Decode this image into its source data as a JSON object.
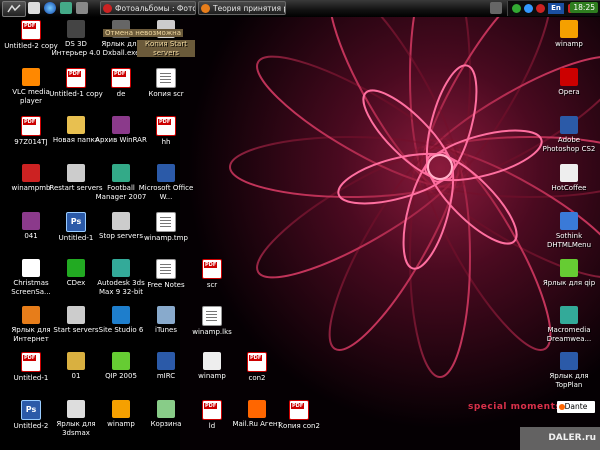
{
  "taskbar": {
    "start_label": "",
    "tasks": [
      {
        "label": "Фотоальбомы : Фото..."
      },
      {
        "label": "Теория принятия ре..."
      }
    ],
    "language": "En",
    "clock": "18:25"
  },
  "desktop": {
    "icons": [
      {
        "label": "Untitled-2 copy",
        "icon": "pdf-icon"
      },
      {
        "label": "DS 3D Интерьер 4.0",
        "icon": "ds3d-icon"
      },
      {
        "label": "Ярлык для Dxball.exe",
        "icon": "dxball-icon"
      },
      {
        "label": "Копия Start servers",
        "icon": "batch-icon",
        "note": "Отмена невозможна"
      },
      {
        "label": "VLC media player",
        "icon": "vlc-cone-icon"
      },
      {
        "label": "Untitled-1 copy",
        "icon": "pdf-icon"
      },
      {
        "label": "de",
        "icon": "pdf-icon"
      },
      {
        "label": "Копия scr",
        "icon": "text-file-icon"
      },
      {
        "label": "97Z014TJ",
        "icon": "pdf-icon"
      },
      {
        "label": "Новая папка",
        "icon": "folder-icon"
      },
      {
        "label": "Архив WinRAR",
        "icon": "winrar-icon"
      },
      {
        "label": "hh",
        "icon": "pdf-icon"
      },
      {
        "label": "winampmb",
        "icon": "winampmb-icon"
      },
      {
        "label": "Restart servers",
        "icon": "batch-icon"
      },
      {
        "label": "Football Manager 2007",
        "icon": "football-manager-icon"
      },
      {
        "label": "Microsoft Office W...",
        "icon": "word-icon"
      },
      {
        "label": "041",
        "icon": "winrar-icon"
      },
      {
        "label": "Untitled-1",
        "icon": "photoshop-icon"
      },
      {
        "label": "Stop servers",
        "icon": "batch-icon"
      },
      {
        "label": "winamp.tmp",
        "icon": "text-file-icon"
      },
      {
        "label": "Christmas ScreenSa...",
        "icon": "snowflake-icon"
      },
      {
        "label": "CDex",
        "icon": "cdex-icon"
      },
      {
        "label": "Autodesk 3ds Max 9 32-bit",
        "icon": "3dsmax-icon"
      },
      {
        "label": "Free Notes",
        "icon": "text-file-icon"
      },
      {
        "label": "scr",
        "icon": "pdf-icon"
      },
      {
        "label": "Ярлык для Интернет",
        "icon": "firefox-icon"
      },
      {
        "label": "Start servers",
        "icon": "batch-icon"
      },
      {
        "label": "Site Studio 6",
        "icon": "site-studio-icon"
      },
      {
        "label": "iTunes",
        "icon": "itunes-icon"
      },
      {
        "label": "winamp.lks",
        "icon": "text-file-icon"
      },
      {
        "label": "Untitled-1",
        "icon": "pdf-icon"
      },
      {
        "label": "01",
        "icon": "zip-icon"
      },
      {
        "label": "QIP 2005",
        "icon": "qip-icon"
      },
      {
        "label": "mIRC",
        "icon": "mirc-icon"
      },
      {
        "label": "winamp",
        "icon": "shortcut-icon"
      },
      {
        "label": "con2",
        "icon": "pdf-icon"
      },
      {
        "label": "Untitled-2",
        "icon": "photoshop-icon"
      },
      {
        "label": "Ярлык для 3dsmax",
        "icon": "window-icon"
      },
      {
        "label": "winamp",
        "icon": "winamp-icon"
      },
      {
        "label": "Корзина",
        "icon": "recycle-bin-icon"
      },
      {
        "label": "ld",
        "icon": "pdf-icon"
      },
      {
        "label": "Mail.Ru Агент",
        "icon": "mailru-agent-icon"
      },
      {
        "label": "Копия con2",
        "icon": "pdf-icon"
      }
    ],
    "right_icons": [
      {
        "label": "winamp",
        "icon": "winamp-icon"
      },
      {
        "label": "Opera",
        "icon": "opera-icon"
      },
      {
        "label": "Adobe Photoshop CS2",
        "icon": "photoshop-cs2-icon"
      },
      {
        "label": "HotCoffee",
        "icon": "hotcoffee-icon"
      },
      {
        "label": "Sothink DHTMLMenu",
        "icon": "sothink-icon"
      },
      {
        "label": "Ярлык для qip",
        "icon": "qip-icon"
      },
      {
        "label": "Macromedia Dreamwea...",
        "icon": "dreamweaver-icon"
      },
      {
        "label": "Ярлык для TopPlan",
        "icon": "topplan-icon"
      }
    ]
  },
  "wallpaper": {
    "caption": "special moments",
    "accent": "#d9304a"
  },
  "tray_widget": {
    "label": "Dante"
  },
  "watermark": {
    "text": "DALER.ru"
  }
}
